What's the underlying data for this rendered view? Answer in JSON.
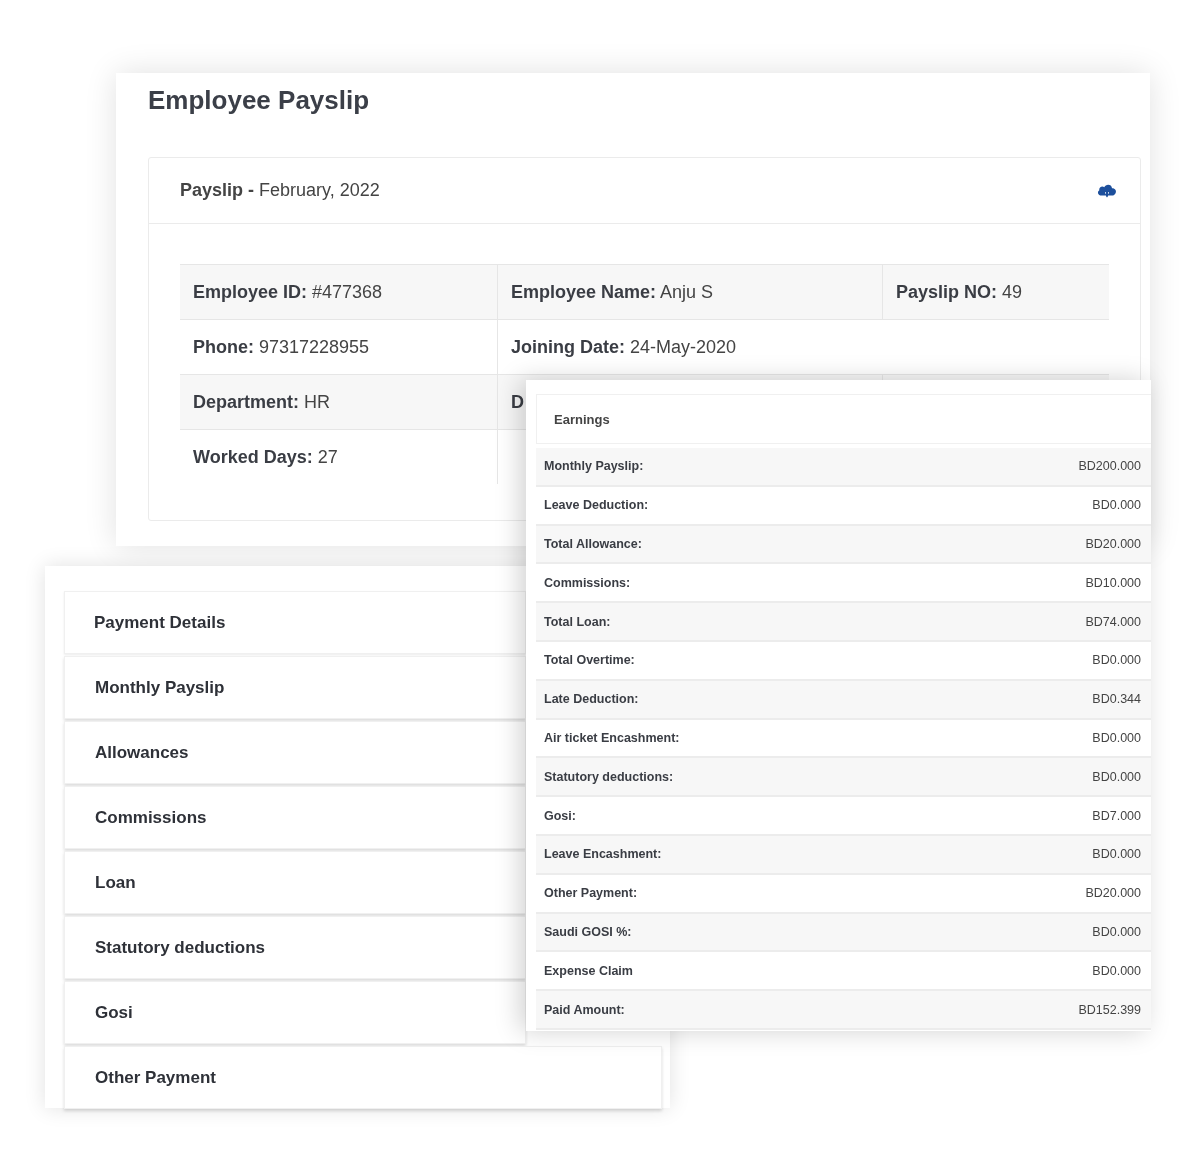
{
  "payslip_window": {
    "title": "Employee Payslip",
    "header": {
      "label": "Payslip -",
      "period": "February, 2022"
    },
    "info_rows": [
      {
        "cells": [
          {
            "label": "Employee ID:",
            "value": "#477368"
          },
          {
            "label": "Employee Name:",
            "value": "Anju S"
          },
          {
            "label": "Payslip NO:",
            "value": "49"
          }
        ]
      },
      {
        "cells": [
          {
            "label": "Phone:",
            "value": "97317228955"
          },
          {
            "label": "Joining Date:",
            "value": "24-May-2020"
          }
        ]
      },
      {
        "cells": [
          {
            "label": "Department:",
            "value": "HR"
          },
          {
            "label": "D"
          }
        ]
      },
      {
        "cells": [
          {
            "label": "Worked Days:",
            "value": "27"
          }
        ]
      }
    ]
  },
  "payment_menu": {
    "title": "Payment Details",
    "items": [
      "Monthly Payslip",
      "Allowances",
      "Commissions",
      "Loan",
      "Statutory deductions",
      "Gosi",
      "Other Payment"
    ]
  },
  "earnings": {
    "title": "Earnings",
    "rows": [
      {
        "label": "Monthly Payslip:",
        "value": "BD200.000"
      },
      {
        "label": "Leave Deduction:",
        "value": "BD0.000"
      },
      {
        "label": "Total Allowance:",
        "value": "BD20.000"
      },
      {
        "label": "Commissions:",
        "value": "BD10.000"
      },
      {
        "label": "Total Loan:",
        "value": "BD74.000"
      },
      {
        "label": "Total Overtime:",
        "value": "BD0.000"
      },
      {
        "label": "Late Deduction:",
        "value": "BD0.344"
      },
      {
        "label": "Air ticket Encashment:",
        "value": "BD0.000"
      },
      {
        "label": "Statutory deductions:",
        "value": "BD0.000"
      },
      {
        "label": "Gosi:",
        "value": "BD7.000"
      },
      {
        "label": "Leave Encashment:",
        "value": "BD0.000"
      },
      {
        "label": "Other Payment:",
        "value": "BD20.000"
      },
      {
        "label": "Saudi GOSI %:",
        "value": "BD0.000"
      },
      {
        "label": "Expense Claim",
        "value": "BD0.000"
      },
      {
        "label": "Paid Amount:",
        "value": "BD152.399"
      }
    ]
  }
}
